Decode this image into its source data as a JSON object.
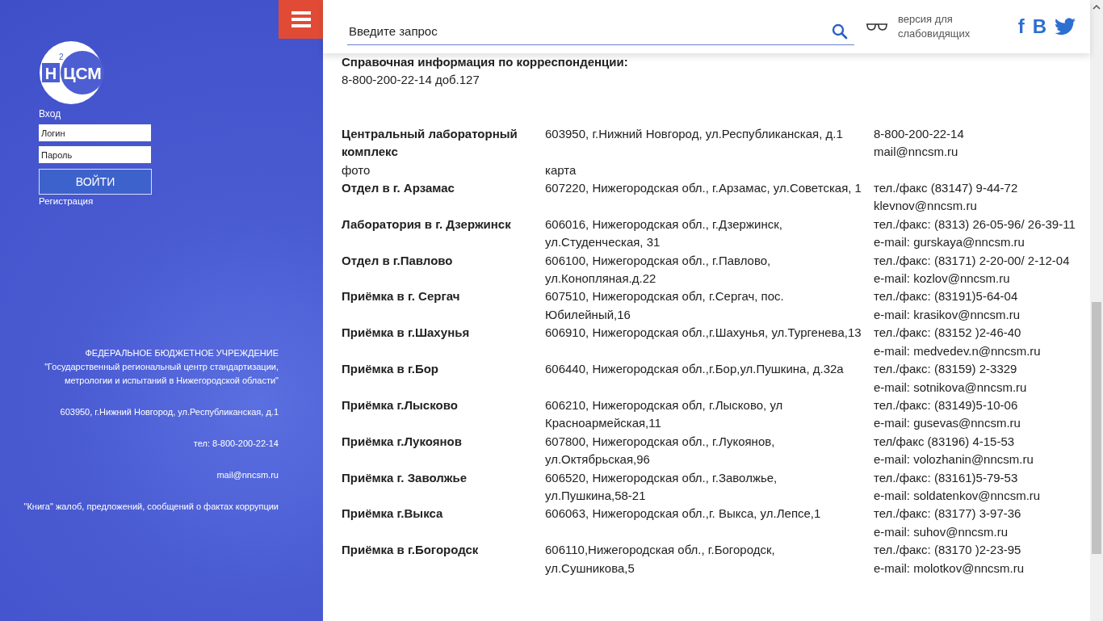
{
  "sidebar": {
    "logo": {
      "main": "ЦСМ",
      "left": "Н",
      "superscript": "2"
    },
    "login": {
      "title": "Вход",
      "login_placeholder": "Логин",
      "password_placeholder": "Пароль",
      "button": "ВОЙТИ",
      "register": "Регистрация"
    },
    "org": {
      "type": "ФЕДЕРАЛЬНОЕ БЮДЖЕТНОЕ УЧРЕЖДЕНИЕ",
      "name": "\"Государственный региональный центр стандартизации, метрологии и испытаний в Нижегородской области\""
    },
    "footer_items": [
      "603950, г.Нижний Новгород, ул.Республиканская, д.1",
      "тел: 8-800-200-22-14",
      "mail@nncsm.ru",
      "\"Книга\" жалоб, предложений, сообщений о фактах коррупции"
    ]
  },
  "header": {
    "search_placeholder": "Введите запрос",
    "accessibility": "версия для слабовидящих",
    "social": [
      {
        "kind": "letter",
        "label": "f"
      },
      {
        "kind": "letter",
        "label": "В"
      },
      {
        "kind": "bird"
      }
    ]
  },
  "info": {
    "title": "Справочная информация по корреспонденции:",
    "phone": "8-800-200-22-14 доб.127"
  },
  "offices": [
    {
      "name": "Центральный лабораторный комплекс",
      "address": " 603950, г.Нижний Новгород, ул.Республиканская, д.1",
      "contacts": [
        "8-800-200-22-14",
        "mail@nncsm.ru"
      ],
      "links": [
        "фото",
        "карта"
      ]
    },
    {
      "name": "Отдел в г. Арзамас",
      "address": "607220, Нижегородская обл., г.Арзамас, ул.Советская, 1",
      "contacts": [
        "тел./факс (83147) 9-44-72",
        "klevnov@nncsm.ru"
      ]
    },
    {
      "name": "Лаборатория в г. Дзержинск",
      "address": "606016, Нижегородская обл., г.Дзержинск, ул.Студенческая, 31",
      "contacts": [
        "тел./факс: (8313) 26-05-96/ 26-39-11",
        "e-mail: gurskaya@nncsm.ru"
      ]
    },
    {
      "name": "Отдел в г.Павлово",
      "address": "606100, Нижегородская обл., г.Павлово, ул.Конопляная.д.22",
      "contacts": [
        "тел./факс: (83171) 2-20-00/ 2-12-04",
        "e-mail: kozlov@nncsm.ru"
      ]
    },
    {
      "name": "Приёмка в г. Сергач",
      "address": "607510, Нижегородская обл, г.Сергач, пос. Юбилейный,16",
      "contacts": [
        "тел./факс: (83191)5-64-04",
        "e-mail: krasikov@nncsm.ru"
      ]
    },
    {
      "name": "Приёмка в г.Шахунья",
      "address": "606910, Нижегородская обл.,г.Шахунья, ул.Тургенева,13",
      "contacts": [
        "тел./факс: (83152 )2-46-40",
        "e-mail: medvedev.n@nncsm.ru"
      ]
    },
    {
      "name": "Приёмка в г.Бор",
      "address": "606440, Нижегородская обл.,г.Бор,ул.Пушкина, д.32а",
      "contacts": [
        "тел./факс: (83159) 2-3329",
        "e-mail: sotnikova@nncsm.ru"
      ]
    },
    {
      "name": "Приёмка г.Лысково",
      "address": "606210, Нижегородская обл, г.Лысково, ул Красноармейская,11",
      "contacts": [
        "тел./факс: (83149)5-10-06",
        "e-mail: gusevas@nncsm.ru"
      ]
    },
    {
      "name": "Приёмка г.Лукоянов",
      "address": "607800, Нижегородская обл., г.Лукоянов, ул.Октябрьская,96",
      "contacts": [
        "тел/факс (83196) 4-15-53",
        "e-mail: volozhanin@nncsm.ru"
      ]
    },
    {
      "name": "Приёмка г. Заволжье",
      "address": "606520, Нижегородская обл., г.Заволжье, ул.Пушкина,58-21",
      "contacts": [
        "тел./факс: (83161)5-79-53",
        "e-mail: soldatenkov@nncsm.ru"
      ]
    },
    {
      "name": "Приёмка г.Выкса",
      "address": "606063, Нижегородская обл.,г. Выкса, ул.Лепсе,1",
      "contacts": [
        "тел./факс: (83177) 3-97-36",
        "e-mail: suhov@nncsm.ru"
      ]
    },
    {
      "name": "Приёмка в г.Богородск",
      "address": "606110,Нижегородская обл., г.Богородск, ул.Сушникова,5",
      "contacts": [
        "тел./факс: (83170 )2-23-95",
        "e-mail: molotkov@nncsm.ru"
      ]
    }
  ]
}
